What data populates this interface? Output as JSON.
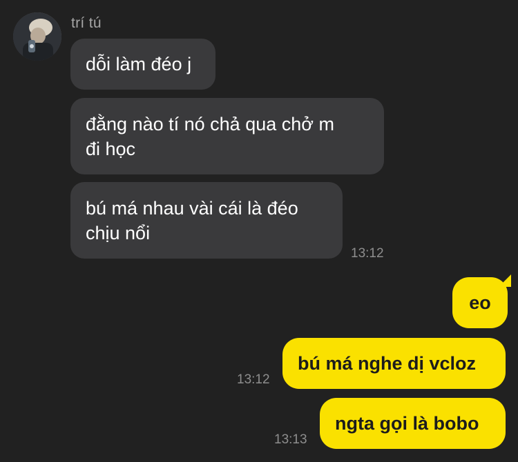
{
  "conversation": {
    "sender_name": "trí tú",
    "incoming": [
      {
        "text": "dỗi làm đéo j"
      },
      {
        "text": "đằng nào tí nó chả qua chở m\nđi học"
      },
      {
        "text": "bú má nhau vài cái là đéo\nchịu nổi"
      }
    ],
    "incoming_time": "13:12",
    "outgoing": [
      {
        "text": "eo"
      },
      {
        "text": "bú má nghe dị vcloz",
        "time": "13:12"
      },
      {
        "text": "ngta gọi là bobo",
        "time": "13:13"
      }
    ]
  },
  "colors": {
    "background": "#212121",
    "incoming_bubble": "#3a3a3c",
    "outgoing_bubble": "#fae100",
    "timestamp": "#8e8e8e",
    "sender_name": "#a6a6a6"
  },
  "icons": {
    "avatar": "profile-photo"
  }
}
